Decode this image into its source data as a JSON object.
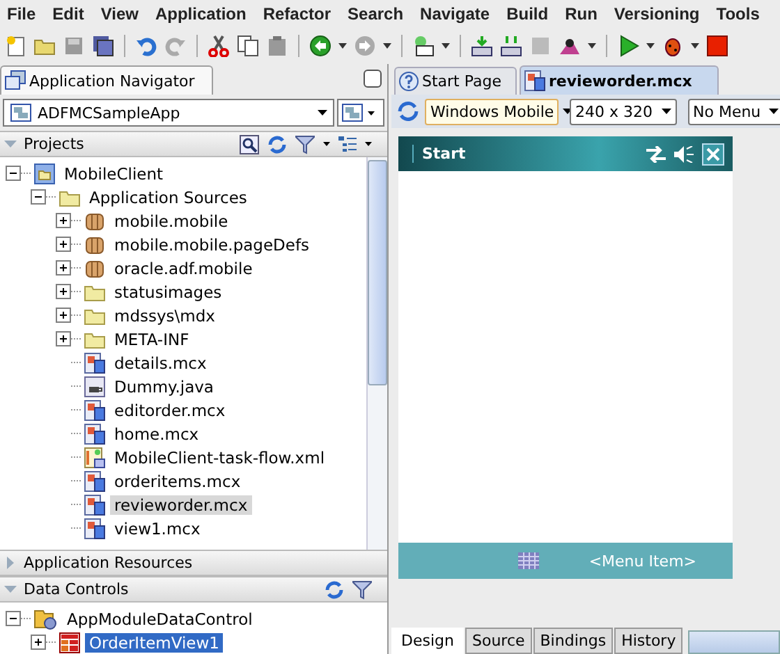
{
  "menu": [
    {
      "label": "File"
    },
    {
      "label": "Edit"
    },
    {
      "label": "View"
    },
    {
      "label": "Application"
    },
    {
      "label": "Refactor"
    },
    {
      "label": "Search"
    },
    {
      "label": "Navigate"
    },
    {
      "label": "Build"
    },
    {
      "label": "Run"
    },
    {
      "label": "Versioning"
    },
    {
      "label": "Tools"
    }
  ],
  "navigator": {
    "title": "Application Navigator",
    "application": "ADFMCSampleApp",
    "sections": [
      {
        "title": "Projects",
        "expanded": true,
        "tree": [
          {
            "label": "MobileClient",
            "kind": "project",
            "expanded": true,
            "selected": false,
            "children": [
              {
                "label": "Application Sources",
                "kind": "folder",
                "expanded": true,
                "selected": false,
                "children": [
                  {
                    "label": "mobile.mobile",
                    "kind": "package",
                    "expanded": false,
                    "selected": false
                  },
                  {
                    "label": "mobile.mobile.pageDefs",
                    "kind": "package",
                    "expanded": false,
                    "selected": false
                  },
                  {
                    "label": "oracle.adf.mobile",
                    "kind": "package",
                    "expanded": false,
                    "selected": false
                  },
                  {
                    "label": "statusimages",
                    "kind": "folder",
                    "expanded": false,
                    "selected": false
                  },
                  {
                    "label": "mdssys\\mdx",
                    "kind": "folder",
                    "expanded": false,
                    "selected": false
                  },
                  {
                    "label": "META-INF",
                    "kind": "folder",
                    "expanded": false,
                    "selected": false
                  },
                  {
                    "label": "details.mcx",
                    "kind": "mcx",
                    "selected": false
                  },
                  {
                    "label": "Dummy.java",
                    "kind": "java",
                    "selected": false
                  },
                  {
                    "label": "editorder.mcx",
                    "kind": "mcx",
                    "selected": false
                  },
                  {
                    "label": "home.mcx",
                    "kind": "mcx",
                    "selected": false
                  },
                  {
                    "label": "MobileClient-task-flow.xml",
                    "kind": "taskflow",
                    "selected": false
                  },
                  {
                    "label": "orderitems.mcx",
                    "kind": "mcx",
                    "selected": false
                  },
                  {
                    "label": "revieworder.mcx",
                    "kind": "mcx",
                    "selected": true
                  },
                  {
                    "label": "view1.mcx",
                    "kind": "mcx",
                    "selected": false
                  }
                ]
              }
            ]
          }
        ]
      },
      {
        "title": "Application Resources",
        "expanded": false
      },
      {
        "title": "Data Controls",
        "expanded": true,
        "tree": [
          {
            "label": "AppModuleDataControl",
            "kind": "datacontrol",
            "expanded": true,
            "selected": false,
            "children": [
              {
                "label": "OrderItemView1",
                "kind": "viewobject",
                "expanded": false,
                "selected": true
              }
            ]
          }
        ]
      }
    ]
  },
  "editor": {
    "tabs": [
      {
        "label": "Start Page",
        "selected": false
      },
      {
        "label": "revieworder.mcx",
        "selected": true
      }
    ],
    "selectors": [
      "Windows Mobile",
      "240 x 320",
      "No Menu"
    ],
    "device": {
      "title": "Start",
      "menu_item": "<Menu Item>"
    },
    "bottom_tabs": [
      {
        "label": "Design",
        "selected": true
      },
      {
        "label": "Source",
        "selected": false
      },
      {
        "label": "Bindings",
        "selected": false
      },
      {
        "label": "History",
        "selected": false
      }
    ]
  }
}
